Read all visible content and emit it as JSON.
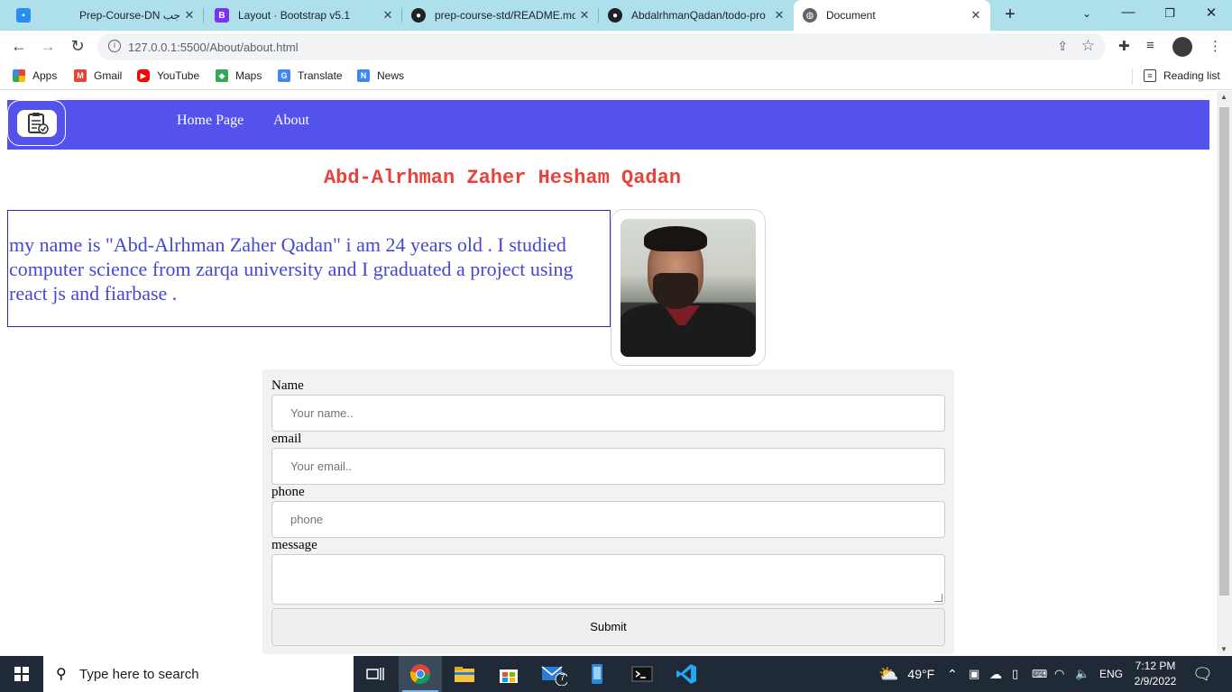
{
  "browser": {
    "tabs": [
      {
        "title": "Prep-Course-DN واجب",
        "icon": "google-classroom-icon",
        "color": "#2a8bf2"
      },
      {
        "title": "Layout · Bootstrap v5.1",
        "icon": "bootstrap-icon",
        "color": "#7b2ff7"
      },
      {
        "title": "prep-course-std/README.md",
        "icon": "github-icon",
        "color": "#202124"
      },
      {
        "title": "AbdalrhmanQadan/todo-pro",
        "icon": "github-icon",
        "color": "#202124"
      },
      {
        "title": "Document",
        "icon": "globe-icon",
        "color": "#5f6368"
      }
    ],
    "active_tab": 4,
    "url": "127.0.0.1:5500/About/about.html",
    "bookmarks": [
      {
        "label": "Apps",
        "icon": "apps-grid-icon"
      },
      {
        "label": "Gmail",
        "icon": "gmail-icon"
      },
      {
        "label": "YouTube",
        "icon": "youtube-icon"
      },
      {
        "label": "Maps",
        "icon": "maps-icon"
      },
      {
        "label": "Translate",
        "icon": "translate-icon"
      },
      {
        "label": "News",
        "icon": "news-icon"
      }
    ],
    "reading_list": "Reading list"
  },
  "page": {
    "nav": {
      "links": [
        "Home Page",
        "About"
      ],
      "bg_color": "#5352ed"
    },
    "heading": "Abd-Alrhman Zaher Hesham Qadan",
    "bio": "my name is \"Abd-Alrhman Zaher Qadan\" i am 24 years old . I studied computer science from zarqa university and I graduated a project using react js and fiarbase .",
    "form": {
      "name_label": "Name",
      "name_placeholder": "Your name..",
      "email_label": "email",
      "email_placeholder": "Your email..",
      "phone_label": "phone",
      "phone_placeholder": "phone",
      "message_label": "message",
      "submit_label": "Submit"
    }
  },
  "taskbar": {
    "search_placeholder": "Type here to search",
    "weather": "49°F",
    "language": "ENG",
    "time": "7:12 PM",
    "date": "2/9/2022",
    "mail_badge": "7"
  }
}
